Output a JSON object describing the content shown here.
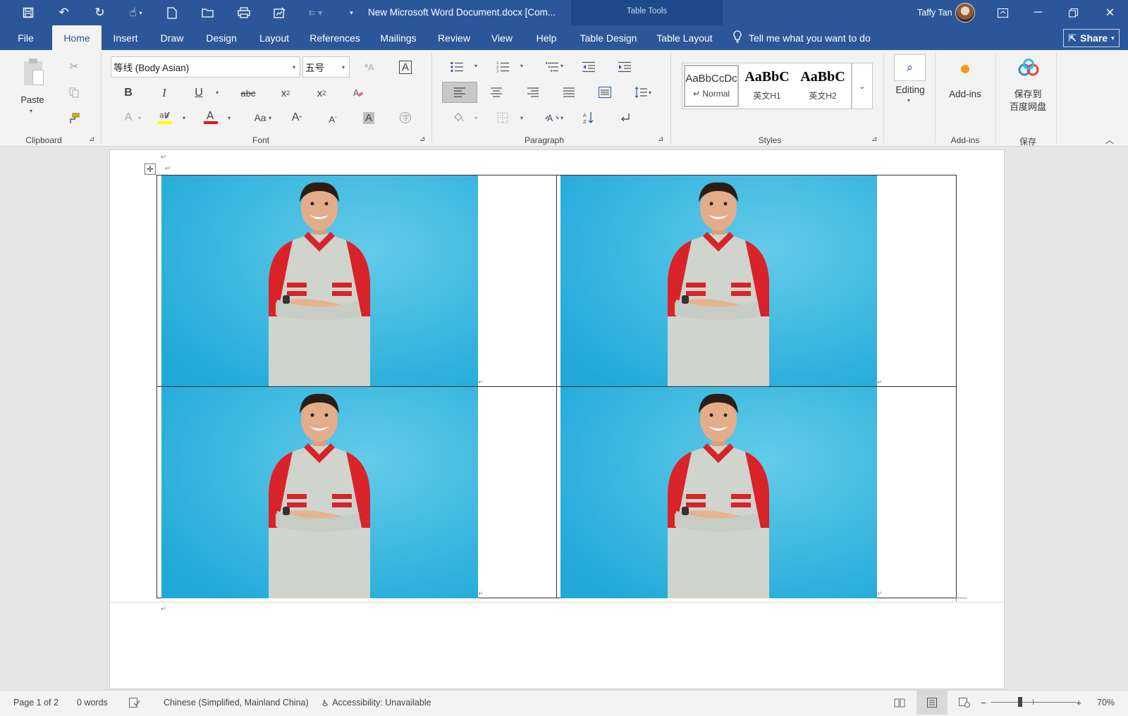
{
  "window": {
    "title": "New Microsoft Word Document.docx [Com...",
    "context_tab_group": "Table Tools",
    "user_name": "Taffy Tan"
  },
  "tabs": [
    "File",
    "Home",
    "Insert",
    "Draw",
    "Design",
    "Layout",
    "References",
    "Mailings",
    "Review",
    "View",
    "Help",
    "Table Design",
    "Table Layout"
  ],
  "active_tab": "Home",
  "tell_me": "Tell me what you want to do",
  "share_label": "Share",
  "ribbon": {
    "clipboard": {
      "paste_label": "Paste",
      "group_label": "Clipboard"
    },
    "font": {
      "font_name": "等线 (Body Asian)",
      "font_size": "五号",
      "group_label": "Font",
      "aa_label": "Aa",
      "bold": "B",
      "italic": "I",
      "underline": "U",
      "strike": "abc",
      "grow": "A",
      "shrink": "A"
    },
    "paragraph": {
      "group_label": "Paragraph"
    },
    "styles": {
      "group_label": "Styles",
      "items": [
        {
          "preview": "AaBbCcDc",
          "name": "↵ Normal"
        },
        {
          "preview": "AaBbC",
          "name": "英文H1"
        },
        {
          "preview": "AaBbC",
          "name": "英文H2"
        }
      ]
    },
    "editing": {
      "label": "Editing"
    },
    "addins": {
      "label": "Add-ins",
      "group_label": "Add-ins"
    },
    "baidu": {
      "line1": "保存到",
      "line2": "百度网盘",
      "group_label": "保存"
    }
  },
  "document": {
    "paragraph_mark": "↵",
    "table_move_handle": "✛"
  },
  "status": {
    "page": "Page 1 of 2",
    "words": "0 words",
    "language": "Chinese (Simplified, Mainland China)",
    "accessibility": "Accessibility: Unavailable",
    "zoom": "70%"
  },
  "colors": {
    "brand_blue": "#2b579a",
    "photo_background": "#2fb3df",
    "font_color_bar": "#e81123",
    "highlight_bar": "#ffff00"
  }
}
